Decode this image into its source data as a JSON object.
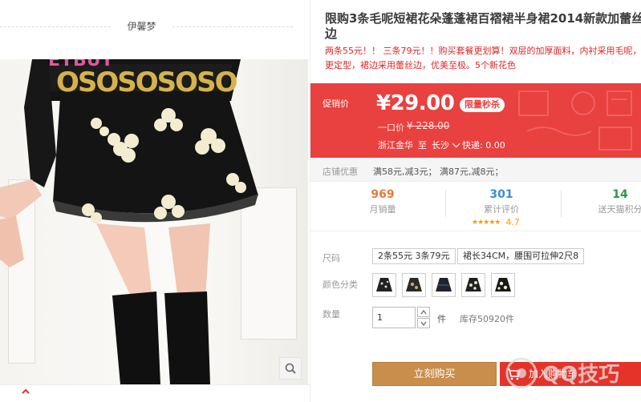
{
  "shop": {
    "name": "伊馨梦"
  },
  "product": {
    "title": "限购3条毛呢短裙花朵蓬蓬裙百褶裙半身裙2014新款加蕾丝边",
    "subtitle": "两条55元！！ 三条79元！！购买套餐更划算！双层的加厚面料，内衬采用毛呢，更定型，裙边采用蕾丝边，优美至极。5个新花色"
  },
  "price": {
    "label": "促销价",
    "current": "¥29.00",
    "badge": "限量秒杀",
    "old_label": "一口价",
    "old": "¥ 228.00"
  },
  "shipping": {
    "from": "浙江金华",
    "to_label": "至",
    "to": "长沙",
    "fee": "快递: 0.00"
  },
  "promo": {
    "label": "店铺优惠",
    "text": "满58元,减3元； 满87元,减8元；"
  },
  "stats": [
    {
      "value": "969",
      "label": "月销量",
      "color": "#e57a3a"
    },
    {
      "value": "301",
      "label": "累计评价",
      "color": "#3a8fd1"
    },
    {
      "value": "14",
      "label": "送天猫积分",
      "color": "#2b9a3c"
    }
  ],
  "rating": {
    "stars": "★★★★★",
    "value": "4.7"
  },
  "size": {
    "label": "尺码",
    "options": [
      "2条55元 3条79元",
      "裙长34CM，腰围可拉伸2尺8"
    ]
  },
  "color": {
    "label": "颜色分类"
  },
  "quantity": {
    "label": "数量",
    "value": "1",
    "unit": "件",
    "stock": "库存50920件"
  },
  "actions": {
    "buy": "立刻购买",
    "cart": "加入购物车"
  },
  "watermark": {
    "text": "QQ技巧"
  }
}
